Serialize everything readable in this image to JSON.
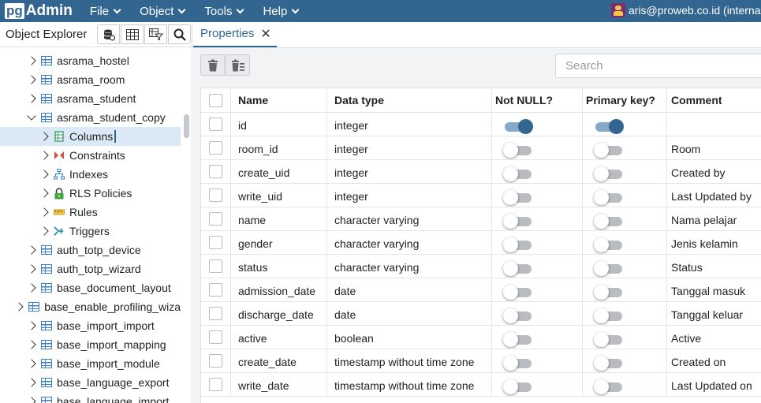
{
  "app": {
    "logo_pg": "pg",
    "logo_admin": "Admin",
    "user": "aris@proweb.co.id (interna"
  },
  "menu": [
    {
      "label": "File"
    },
    {
      "label": "Object"
    },
    {
      "label": "Tools"
    },
    {
      "label": "Help"
    }
  ],
  "object_explorer": {
    "title": "Object Explorer"
  },
  "tree": [
    {
      "label": "asrama_hostel",
      "level": 1,
      "icon": "table-icon",
      "expanded": false
    },
    {
      "label": "asrama_room",
      "level": 1,
      "icon": "table-icon",
      "expanded": false
    },
    {
      "label": "asrama_student",
      "level": 1,
      "icon": "table-icon",
      "expanded": false
    },
    {
      "label": "asrama_student_copy",
      "level": 1,
      "icon": "table-icon",
      "expanded": true
    },
    {
      "label": "Columns",
      "level": 2,
      "icon": "columns-icon",
      "expanded": false,
      "selected": true
    },
    {
      "label": "Constraints",
      "level": 2,
      "icon": "constraints-icon",
      "expanded": false
    },
    {
      "label": "Indexes",
      "level": 2,
      "icon": "indexes-icon",
      "expanded": false
    },
    {
      "label": "RLS Policies",
      "level": 2,
      "icon": "rls-policies-icon",
      "expanded": false
    },
    {
      "label": "Rules",
      "level": 2,
      "icon": "rules-icon",
      "expanded": false
    },
    {
      "label": "Triggers",
      "level": 2,
      "icon": "triggers-icon",
      "expanded": false
    },
    {
      "label": "auth_totp_device",
      "level": 1,
      "icon": "table-icon",
      "expanded": false
    },
    {
      "label": "auth_totp_wizard",
      "level": 1,
      "icon": "table-icon",
      "expanded": false
    },
    {
      "label": "base_document_layout",
      "level": 1,
      "icon": "table-icon",
      "expanded": false
    },
    {
      "label": "base_enable_profiling_wiza",
      "level": 1,
      "icon": "table-icon",
      "expanded": false
    },
    {
      "label": "base_import_import",
      "level": 1,
      "icon": "table-icon",
      "expanded": false
    },
    {
      "label": "base_import_mapping",
      "level": 1,
      "icon": "table-icon",
      "expanded": false
    },
    {
      "label": "base_import_module",
      "level": 1,
      "icon": "table-icon",
      "expanded": false
    },
    {
      "label": "base_language_export",
      "level": 1,
      "icon": "table-icon",
      "expanded": false
    },
    {
      "label": "base_language_import",
      "level": 1,
      "icon": "table-icon",
      "expanded": false
    }
  ],
  "tabs": [
    {
      "label": "Properties",
      "close": "✕"
    }
  ],
  "search": {
    "placeholder": "Search"
  },
  "table": {
    "headers": [
      "Name",
      "Data type",
      "Not NULL?",
      "Primary key?",
      "Comment"
    ],
    "rows": [
      {
        "name": "id",
        "type": "integer",
        "not_null": true,
        "primary_key": true,
        "comment": ""
      },
      {
        "name": "room_id",
        "type": "integer",
        "not_null": false,
        "primary_key": false,
        "comment": "Room"
      },
      {
        "name": "create_uid",
        "type": "integer",
        "not_null": false,
        "primary_key": false,
        "comment": "Created by"
      },
      {
        "name": "write_uid",
        "type": "integer",
        "not_null": false,
        "primary_key": false,
        "comment": "Last Updated by"
      },
      {
        "name": "name",
        "type": "character varying",
        "not_null": false,
        "primary_key": false,
        "comment": "Nama pelajar"
      },
      {
        "name": "gender",
        "type": "character varying",
        "not_null": false,
        "primary_key": false,
        "comment": "Jenis kelamin"
      },
      {
        "name": "status",
        "type": "character varying",
        "not_null": false,
        "primary_key": false,
        "comment": "Status"
      },
      {
        "name": "admission_date",
        "type": "date",
        "not_null": false,
        "primary_key": false,
        "comment": "Tanggal masuk"
      },
      {
        "name": "discharge_date",
        "type": "date",
        "not_null": false,
        "primary_key": false,
        "comment": "Tanggal keluar"
      },
      {
        "name": "active",
        "type": "boolean",
        "not_null": false,
        "primary_key": false,
        "comment": "Active"
      },
      {
        "name": "create_date",
        "type": "timestamp without time zone",
        "not_null": false,
        "primary_key": false,
        "comment": "Created on"
      },
      {
        "name": "write_date",
        "type": "timestamp without time zone",
        "not_null": false,
        "primary_key": false,
        "comment": "Last Updated on"
      }
    ]
  },
  "colors": {
    "brand": "#326690",
    "selected_row": "#dbe9f6",
    "table_icon": "#3a7fcd"
  }
}
